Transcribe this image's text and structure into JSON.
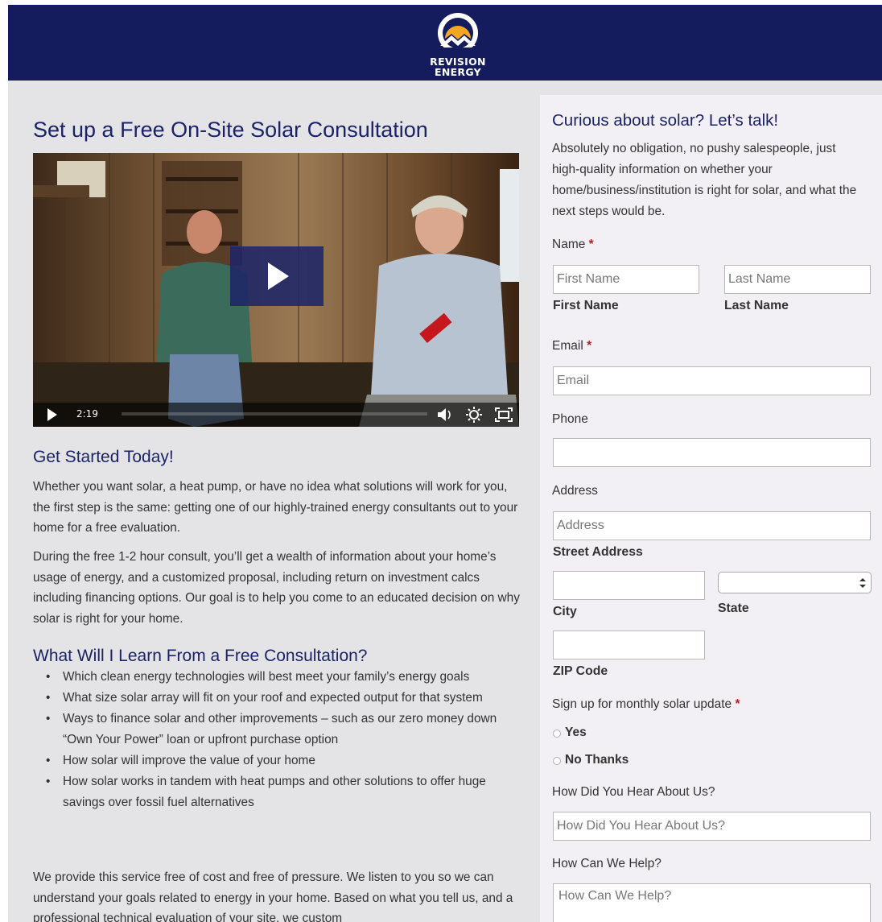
{
  "brand": {
    "line1": "REVISION",
    "line2": "ENERGY"
  },
  "main": {
    "title": "Set up a Free On-Site Solar Consultation",
    "video": {
      "time": "2:19"
    },
    "get_started": {
      "heading": "Get Started Today!",
      "p1": "Whether you want solar, a heat pump, or have no idea what solutions will work for you, the first step is the same: getting one of our highly-trained energy consultants out to your home for a free evaluation.",
      "p2": "During the free 1-2 hour consult, you’ll get a wealth of information about your home’s usage of energy, and a customized proposal, including return on investment calcs including financing options. Our goal is to help you come to an educated decision on why solar is right for your home."
    },
    "learn": {
      "heading": "What Will I Learn From a Free Consultation?",
      "items": [
        "Which clean energy technologies will best meet your family’s energy goals",
        "What size solar array will fit on your roof and expected output for that system",
        "Ways to finance solar and other improvements – such as our zero money down “Own Your Power” loan or upfront purchase option",
        "How solar will improve the value of your home",
        "How solar works in tandem with heat pumps and other solutions to offer huge savings over fossil fuel alternatives"
      ]
    },
    "closing": "We provide this service free of cost and free of pressure. We listen to you so we can understand your goals related to energy in your home. Based on what you tell us, and a professional technical evaluation of your site, we custom"
  },
  "form": {
    "title": "Curious about solar? Let’s talk!",
    "intro": "Absolutely no obligation, no pushy salespeople, just high-quality information on whether your home/business/institution is right for solar, and what the next steps would be.",
    "name_label": "Name",
    "required_mark": "*",
    "first_name": {
      "placeholder": "First Name",
      "sublabel": "First Name"
    },
    "last_name": {
      "placeholder": "Last Name",
      "sublabel": "Last Name"
    },
    "email_label": "Email",
    "email_placeholder": "Email",
    "phone_label": "Phone",
    "address_label": "Address",
    "address_placeholder": "Address",
    "street_sublabel": "Street Address",
    "city_sublabel": "City",
    "state_sublabel": "State",
    "zip_sublabel": "ZIP Code",
    "updates_label": "Sign up for monthly solar update",
    "yes": "Yes",
    "no_thanks": "No Thanks",
    "hear_label": "How Did You Hear About Us?",
    "hear_placeholder": "How Did You Hear About Us?",
    "help_label": "How Can We Help?",
    "help_placeholder": "How Can We Help?"
  }
}
